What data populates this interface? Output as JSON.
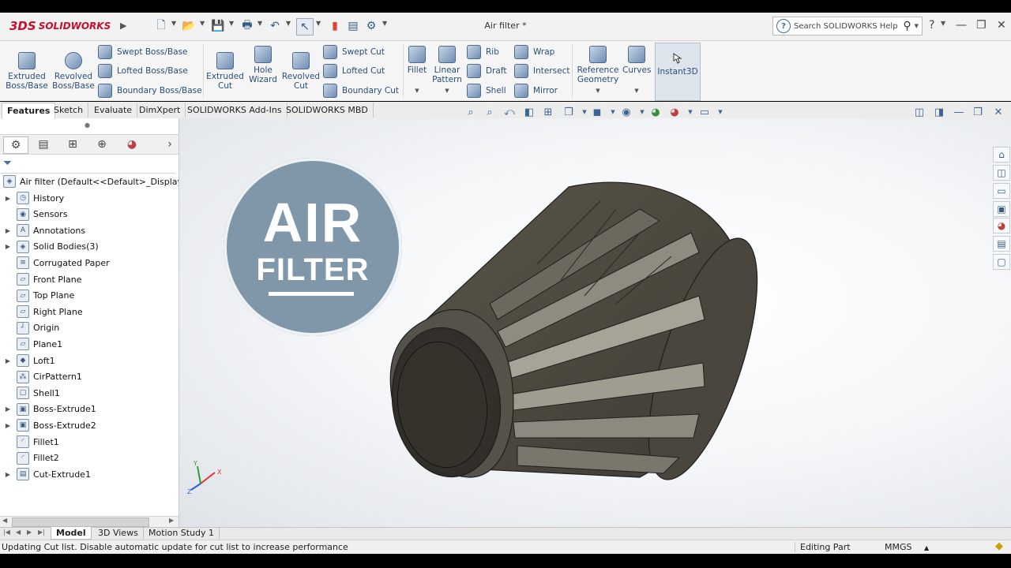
{
  "titlebar": {
    "app_name": "SOLIDWORKS",
    "logo_mark": "3DS",
    "document_title": "Air filter *",
    "search_placeholder": "Search SOLIDWORKS Help",
    "help_glyph": "?",
    "window_buttons": [
      "—",
      "❐",
      "✕"
    ]
  },
  "ribbon": {
    "extruded_boss": "Extruded Boss/Base",
    "revolved_boss": "Revolved Boss/Base",
    "swept_boss": "Swept Boss/Base",
    "lofted_boss": "Lofted Boss/Base",
    "boundary_boss": "Boundary Boss/Base",
    "extruded_cut": "Extruded Cut",
    "hole_wizard": "Hole Wizard",
    "revolved_cut": "Revolved Cut",
    "swept_cut": "Swept Cut",
    "lofted_cut": "Lofted Cut",
    "boundary_cut": "Boundary Cut",
    "fillet": "Fillet",
    "linear_pattern": "Linear Pattern",
    "rib": "Rib",
    "draft": "Draft",
    "shell": "Shell",
    "wrap": "Wrap",
    "intersect": "Intersect",
    "mirror": "Mirror",
    "reference_geometry": "Reference Geometry",
    "curves": "Curves",
    "instant3d": "Instant3D"
  },
  "command_tabs": [
    "Features",
    "Sketch",
    "Evaluate",
    "DimXpert",
    "SOLIDWORKS Add-Ins",
    "SOLIDWORKS MBD"
  ],
  "feature_tree": {
    "root": "Air filter  (Default<<Default>_Display Sta",
    "items": [
      {
        "label": "History",
        "expandable": true,
        "icon": "history-icon"
      },
      {
        "label": "Sensors",
        "expandable": false,
        "icon": "sensors-icon"
      },
      {
        "label": "Annotations",
        "expandable": true,
        "icon": "annotations-icon"
      },
      {
        "label": "Solid Bodies(3)",
        "expandable": true,
        "icon": "solid-bodies-icon"
      },
      {
        "label": "Corrugated Paper",
        "expandable": false,
        "icon": "material-icon"
      },
      {
        "label": "Front Plane",
        "expandable": false,
        "icon": "plane-icon"
      },
      {
        "label": "Top Plane",
        "expandable": false,
        "icon": "plane-icon"
      },
      {
        "label": "Right Plane",
        "expandable": false,
        "icon": "plane-icon"
      },
      {
        "label": "Origin",
        "expandable": false,
        "icon": "origin-icon"
      },
      {
        "label": "Plane1",
        "expandable": false,
        "icon": "plane-icon"
      },
      {
        "label": "Loft1",
        "expandable": true,
        "icon": "loft-icon"
      },
      {
        "label": "CirPattern1",
        "expandable": false,
        "icon": "circular-pattern-icon"
      },
      {
        "label": "Shell1",
        "expandable": false,
        "icon": "shell-icon"
      },
      {
        "label": "Boss-Extrude1",
        "expandable": true,
        "icon": "extrude-icon"
      },
      {
        "label": "Boss-Extrude2",
        "expandable": true,
        "icon": "extrude-icon"
      },
      {
        "label": "Fillet1",
        "expandable": false,
        "icon": "fillet-icon"
      },
      {
        "label": "Fillet2",
        "expandable": false,
        "icon": "fillet-icon"
      },
      {
        "label": "Cut-Extrude1",
        "expandable": true,
        "icon": "cut-extrude-icon"
      }
    ]
  },
  "overlay": {
    "line1": "AIR",
    "line2": "FILTER"
  },
  "triad": {
    "x": "X",
    "y": "Y",
    "z": "Z"
  },
  "bottom_tabs": [
    "Model",
    "3D Views",
    "Motion Study 1"
  ],
  "status": {
    "message": "Updating Cut list. Disable automatic update for cut list to increase performance",
    "mode": "Editing Part",
    "units": "MMGS"
  },
  "colors": {
    "accent": "#c8102e",
    "ribbon_text": "#2a4e78",
    "badge": "#7f97a8",
    "model_dark": "#3f3b34",
    "model_light": "#a7a397"
  }
}
